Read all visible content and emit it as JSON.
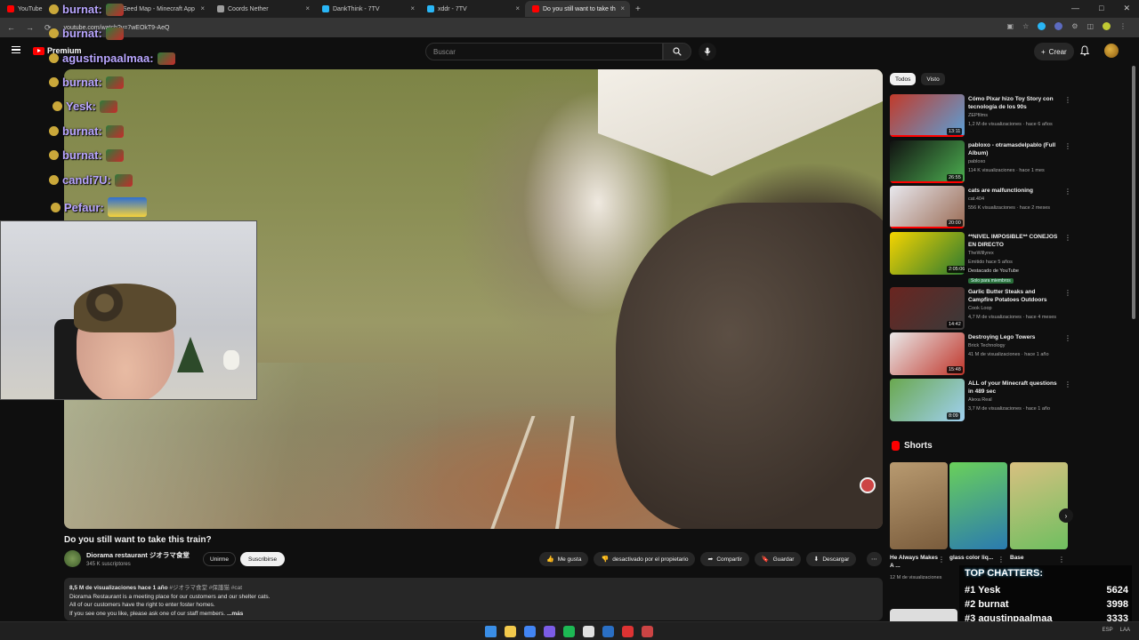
{
  "browser": {
    "tabs": [
      {
        "title": "YouTube",
        "fav": "#ff0000"
      },
      {
        "title": "Seed Map - Minecraft App",
        "fav": "#4caf50"
      },
      {
        "title": "Coords Nether",
        "fav": "#9e9e9e"
      },
      {
        "title": "DankThink - 7TV",
        "fav": "#29b6f6"
      },
      {
        "title": "xddr - 7TV",
        "fav": "#29b6f6"
      },
      {
        "title": "Do you still want to take th",
        "fav": "#ff0000",
        "active": true
      }
    ],
    "url": "youtube.com/watch?v=7wEOkT9-AeQ"
  },
  "masthead": {
    "logo_text": "Premium",
    "search_placeholder": "Buscar",
    "create_label": "Crear",
    "icons": [
      "menu-icon",
      "search-icon",
      "mic-icon",
      "bell-icon"
    ]
  },
  "chat_overlay": [
    {
      "user": "burnat:",
      "color": "#b9a6ff"
    },
    {
      "user": "burnat:",
      "color": "#b9a6ff"
    },
    {
      "user": "agustinpaalmaa:",
      "color": "#b9a6ff"
    },
    {
      "user": "burnat:",
      "color": "#b9a6ff"
    },
    {
      "user": "Yesk:",
      "color": "#b9a6ff"
    },
    {
      "user": "burnat:",
      "color": "#b9a6ff"
    },
    {
      "user": "burnat:",
      "color": "#b9a6ff"
    },
    {
      "user": "candi7U:",
      "color": "#b9a6ff"
    },
    {
      "user": "Pefaur:",
      "color": "#b9a6ff"
    }
  ],
  "video": {
    "title": "Do you still want to take this train?",
    "channel": "Diorama restaurant ジオラマ食堂",
    "subscribers": "345 K suscriptores",
    "join_label": "Unirme",
    "subscribe_label": "Suscribirse",
    "actions": [
      {
        "label": "Me gusta",
        "icon": "thumbs-up-icon"
      },
      {
        "label": "desactivado por el propietario",
        "icon": "thumbs-down-icon"
      },
      {
        "label": "Compartir",
        "icon": "share-icon"
      },
      {
        "label": "Guardar",
        "icon": "save-icon"
      },
      {
        "label": "Descargar",
        "icon": "download-icon"
      }
    ],
    "description": {
      "stats": "8,5 M de visualizaciones  hace 1 año",
      "tags": "#ジオラマ食堂 #保護猫 #cat",
      "lines": [
        "Diorama Restaurant is a meeting place for our customers and our shelter cats.",
        "All of our customers have the right to enter foster homes.",
        "If you see one you like, please ask one of our staff members."
      ],
      "more": "...más"
    }
  },
  "sidebar": {
    "chips": [
      "Todos",
      "Visto"
    ],
    "recommendations": [
      {
        "title": "Cómo Pixar hizo Toy Story con tecnología de los 90s",
        "channel": "ZEPfilms",
        "meta": "1,2 M de visualizaciones · hace 6 años",
        "duration": "13:11",
        "colors": [
          "#c23a2a",
          "#5aa0d8"
        ]
      },
      {
        "title": "pabloxo - otramasdelpablo (Full Album)",
        "channel": "pabloxo",
        "meta": "114 K visualizaciones · hace 1 mes",
        "duration": "26:55",
        "colors": [
          "#111",
          "#4caf50"
        ]
      },
      {
        "title": "cats are malfunctioning",
        "channel": "cat.404",
        "meta": "556 K visualizaciones · hace 2 meses",
        "duration": "20:00",
        "colors": [
          "#e8e8ee",
          "#9a6b54"
        ]
      },
      {
        "title": "**NIVEL IMPOSIBLE** CONEJOS EN DIRECTO",
        "channel": "TheWillyrex",
        "meta": "Emitido hace 5 años",
        "meta2": "Destacado de YouTube",
        "badge": "Solo para miembros",
        "duration": "2:05:06",
        "colors": [
          "#f5d400",
          "#2c7a30"
        ]
      },
      {
        "title": "Garlic Butter Steaks and Campfire Potatoes Outdoors",
        "channel": "Cook Loop",
        "meta": "4,7 M de visualizaciones · hace 4 meses",
        "duration": "14:42",
        "colors": [
          "#6a2520",
          "#3a3a3a"
        ]
      },
      {
        "title": "Destroying Lego Towers",
        "channel": "Brick Technology",
        "meta": "41 M de visualizaciones · hace 1 año",
        "duration": "15:48",
        "colors": [
          "#e9e9e9",
          "#c0362b"
        ]
      },
      {
        "title": "ALL of your Minecraft questions in 489 sec",
        "channel": "Alexa Real",
        "meta": "3,7 M de visualizaciones · hace 1 año",
        "duration": "8:09",
        "colors": [
          "#6aa84f",
          "#9fd0f0"
        ]
      }
    ],
    "shorts_heading": "Shorts",
    "shorts": [
      {
        "title": "He Always Makes A ...",
        "meta": "12 M de visualizaciones",
        "colors": [
          "#b89a70",
          "#7a5c3c"
        ]
      },
      {
        "title": "glass color liq...",
        "meta": "",
        "colors": [
          "#6ad05a",
          "#2a7ab0"
        ]
      },
      {
        "title": "Base",
        "meta": "",
        "colors": [
          "#d8c080",
          "#6fbf60"
        ]
      }
    ]
  },
  "top_chatters": {
    "heading": "TOP CHATTERS:",
    "rows": [
      {
        "rank": "#1",
        "name": "Yesk",
        "count": "5624"
      },
      {
        "rank": "#2",
        "name": "burnat",
        "count": "3998"
      },
      {
        "rank": "#3",
        "name": "agustinpaalmaa",
        "count": "3333"
      }
    ]
  },
  "taskbar": {
    "icon_colors": [
      "#3a8ee6",
      "#f2c94c",
      "#4285f4",
      "#7b5ce6",
      "#1db954",
      "#e0e0e0",
      "#2a6fc4",
      "#d33",
      "#c44"
    ],
    "tray": [
      "ESP",
      "LAA"
    ]
  }
}
